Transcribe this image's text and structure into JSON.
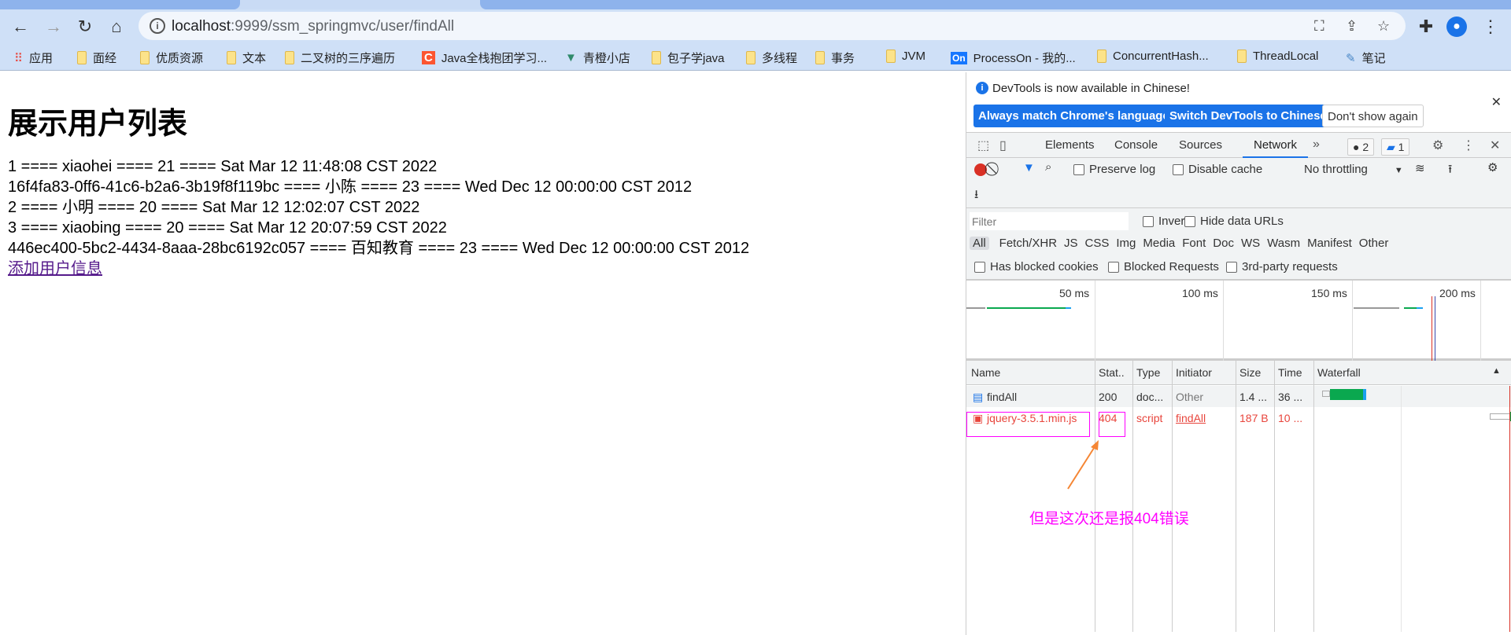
{
  "browser": {
    "url_host": "localhost",
    "url_path": ":9999/ssm_springmvc/user/findAll",
    "bookmarks": [
      {
        "label": "应用",
        "icon": "apps-grid-icon"
      },
      {
        "label": "面经",
        "icon": "folder-icon"
      },
      {
        "label": "优质资源",
        "icon": "folder-icon"
      },
      {
        "label": "文本",
        "icon": "folder-icon"
      },
      {
        "label": "二叉树的三序遍历",
        "icon": "folder-icon"
      },
      {
        "label": "Java全栈抱团学习...",
        "icon": "csdn-icon"
      },
      {
        "label": "青橙小店",
        "icon": "vue-icon"
      },
      {
        "label": "包子学java",
        "icon": "folder-icon"
      },
      {
        "label": "多线程",
        "icon": "folder-icon"
      },
      {
        "label": "事务",
        "icon": "folder-icon"
      },
      {
        "label": "JVM",
        "icon": "folder-icon"
      },
      {
        "label": "ProcessOn - 我的...",
        "icon": "processon-icon"
      },
      {
        "label": "ConcurrentHash...",
        "icon": "folder-icon"
      },
      {
        "label": "ThreadLocal",
        "icon": "folder-icon"
      },
      {
        "label": "笔记",
        "icon": "pen-icon"
      }
    ]
  },
  "page": {
    "title": "展示用户列表",
    "lines": [
      "1 ==== xiaohei ==== 21 ==== Sat Mar 12 11:48:08 CST 2022",
      "16f4fa83-0ff6-41c6-b2a6-3b19f8f119bc ==== 小陈 ==== 23 ==== Wed Dec 12 00:00:00 CST 2012",
      "2 ==== 小明 ==== 20 ==== Sat Mar 12 12:02:07 CST 2022",
      "3 ==== xiaobing ==== 20 ==== Sat Mar 12 20:07:59 CST 2022",
      "446ec400-5bc2-4434-8aaa-28bc6192c057 ==== 百知教育 ==== 23 ==== Wed Dec 12 00:00:00 CST 2012"
    ],
    "link": "添加用户信息"
  },
  "devtools": {
    "banner": {
      "message": "DevTools is now available in Chinese!",
      "btn1": "Always match Chrome's language",
      "btn2": "Switch DevTools to Chinese",
      "btn3": "Don't show again"
    },
    "tabs": [
      "Elements",
      "Console",
      "Sources",
      "Network"
    ],
    "active_tab": "Network",
    "errors": "2",
    "messages": "1",
    "toolbar": {
      "preserve_log": "Preserve log",
      "disable_cache": "Disable cache",
      "throttling": "No throttling"
    },
    "filter": {
      "placeholder": "Filter",
      "invert": "Invert",
      "hide_data": "Hide data URLs",
      "types": [
        "All",
        "Fetch/XHR",
        "JS",
        "CSS",
        "Img",
        "Media",
        "Font",
        "Doc",
        "WS",
        "Wasm",
        "Manifest",
        "Other"
      ],
      "blocked_cookies": "Has blocked cookies",
      "blocked_requests": "Blocked Requests",
      "third_party": "3rd-party requests"
    },
    "overview_ticks": [
      "50 ms",
      "100 ms",
      "150 ms",
      "200 ms"
    ],
    "columns": [
      "Name",
      "Stat..",
      "Type",
      "Initiator",
      "Size",
      "Time",
      "Waterfall"
    ],
    "rows": [
      {
        "name": "findAll",
        "status": "200",
        "type": "doc...",
        "initiator": "Other",
        "size": "1.4 ...",
        "time": "36 ..."
      },
      {
        "name": "jquery-3.5.1.min.js",
        "status": "404",
        "type": "script",
        "initiator": "findAll",
        "size": "187 B",
        "time": "10 ..."
      }
    ],
    "error_color": "#e8453c"
  },
  "annotation": {
    "text": "但是这次还是报404错误",
    "color": "#ff00ff"
  }
}
